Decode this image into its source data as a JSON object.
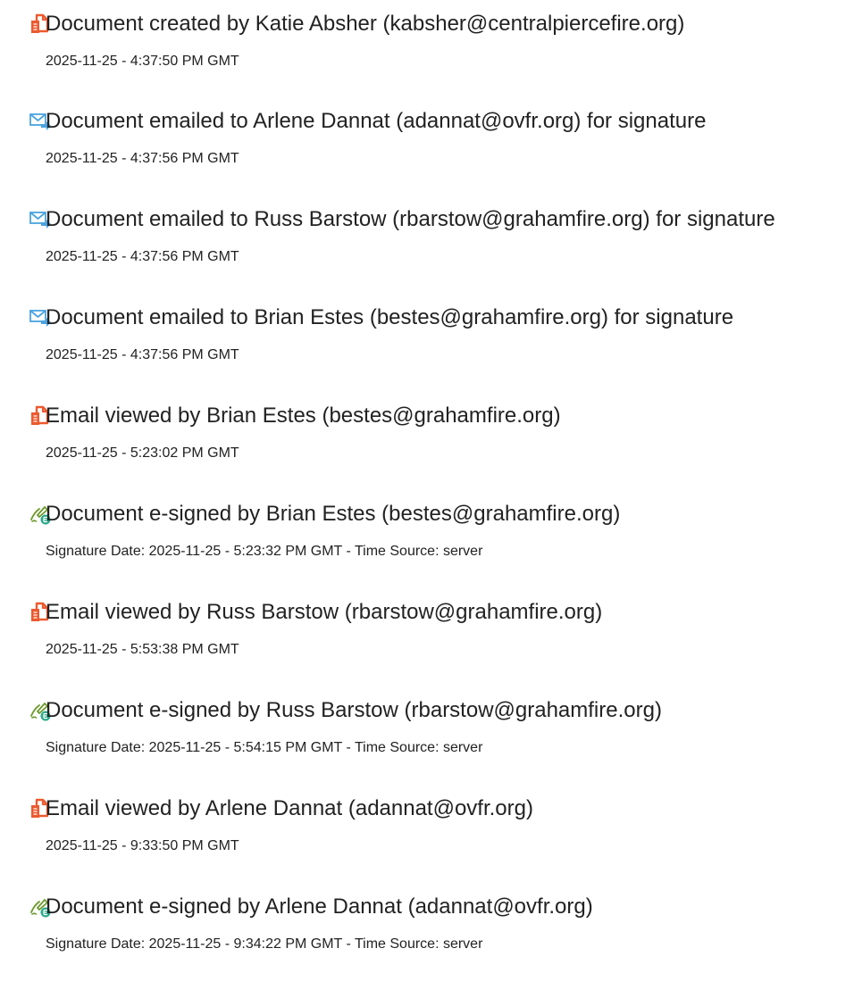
{
  "colors": {
    "doc_icon": "#ec5a2f",
    "email_icon": "#4aa3df",
    "sign_icon_pen": "#6c9a2c",
    "sign_icon_badge": "#2aa88a",
    "text": "#222222"
  },
  "events": [
    {
      "icon": "document-icon",
      "title": "Document created by Katie Absher (kabsher@centralpiercefire.org)",
      "time": "2025-11-25 - 4:37:50 PM GMT"
    },
    {
      "icon": "email-sent-icon",
      "title": "Document emailed to Arlene Dannat (adannat@ovfr.org) for signature",
      "time": "2025-11-25 - 4:37:56 PM GMT"
    },
    {
      "icon": "email-sent-icon",
      "title": "Document emailed to Russ Barstow (rbarstow@grahamfire.org) for signature",
      "time": "2025-11-25 - 4:37:56 PM GMT"
    },
    {
      "icon": "email-sent-icon",
      "title": "Document emailed to Brian Estes (bestes@grahamfire.org) for signature",
      "time": "2025-11-25 - 4:37:56 PM GMT"
    },
    {
      "icon": "document-icon",
      "title": "Email viewed by Brian Estes (bestes@grahamfire.org)",
      "time": "2025-11-25 - 5:23:02 PM GMT"
    },
    {
      "icon": "e-sign-icon",
      "title": "Document e-signed by Brian Estes (bestes@grahamfire.org)",
      "time": "Signature Date: 2025-11-25 - 5:23:32 PM GMT - Time Source: server"
    },
    {
      "icon": "document-icon",
      "title": "Email viewed by Russ Barstow (rbarstow@grahamfire.org)",
      "time": "2025-11-25 - 5:53:38 PM GMT"
    },
    {
      "icon": "e-sign-icon",
      "title": "Document e-signed by Russ Barstow (rbarstow@grahamfire.org)",
      "time": "Signature Date: 2025-11-25 - 5:54:15 PM GMT - Time Source: server"
    },
    {
      "icon": "document-icon",
      "title": "Email viewed by Arlene Dannat (adannat@ovfr.org)",
      "time": "2025-11-25 - 9:33:50 PM GMT"
    },
    {
      "icon": "e-sign-icon",
      "title": "Document e-signed by Arlene Dannat (adannat@ovfr.org)",
      "time": "Signature Date: 2025-11-25 - 9:34:22 PM GMT - Time Source: server"
    }
  ]
}
